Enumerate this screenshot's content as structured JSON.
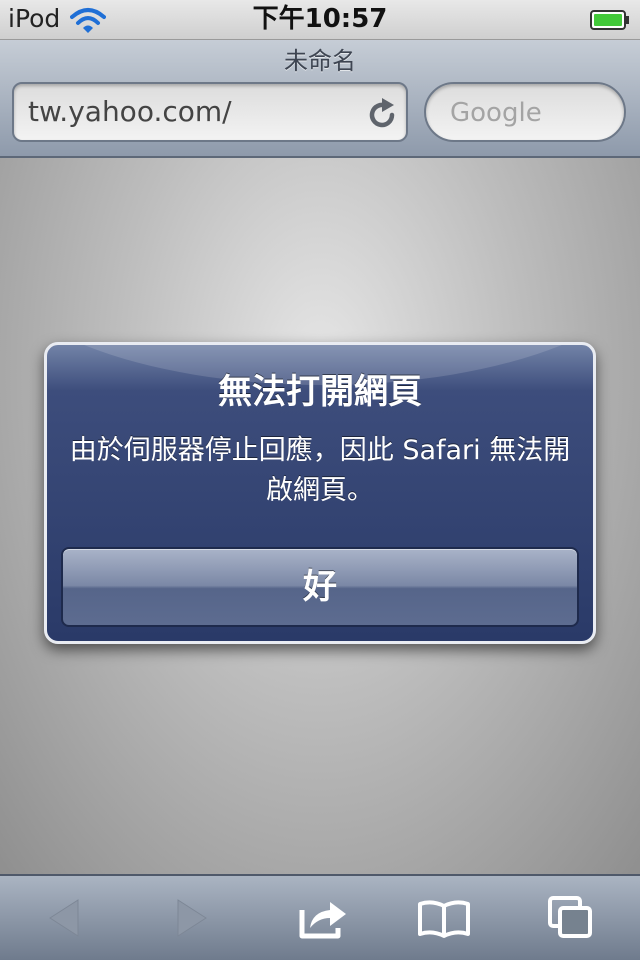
{
  "status_bar": {
    "carrier": "iPod",
    "time": "下午10:57"
  },
  "nav_bar": {
    "page_title": "未命名",
    "url": "tw.yahoo.com/",
    "search_placeholder": "Google"
  },
  "alert": {
    "title": "無法打開網頁",
    "message": "由於伺服器停止回應，因此 Safari 無法開啟網頁。",
    "ok_button": "好"
  },
  "toolbar": {
    "icons": [
      "back-icon",
      "forward-icon",
      "share-icon",
      "bookmarks-icon",
      "tabs-icon"
    ]
  },
  "colors": {
    "alert_bg": "#2a3a68",
    "toolbar_bg": "#6f7b8d",
    "battery_green": "#43c93a"
  }
}
